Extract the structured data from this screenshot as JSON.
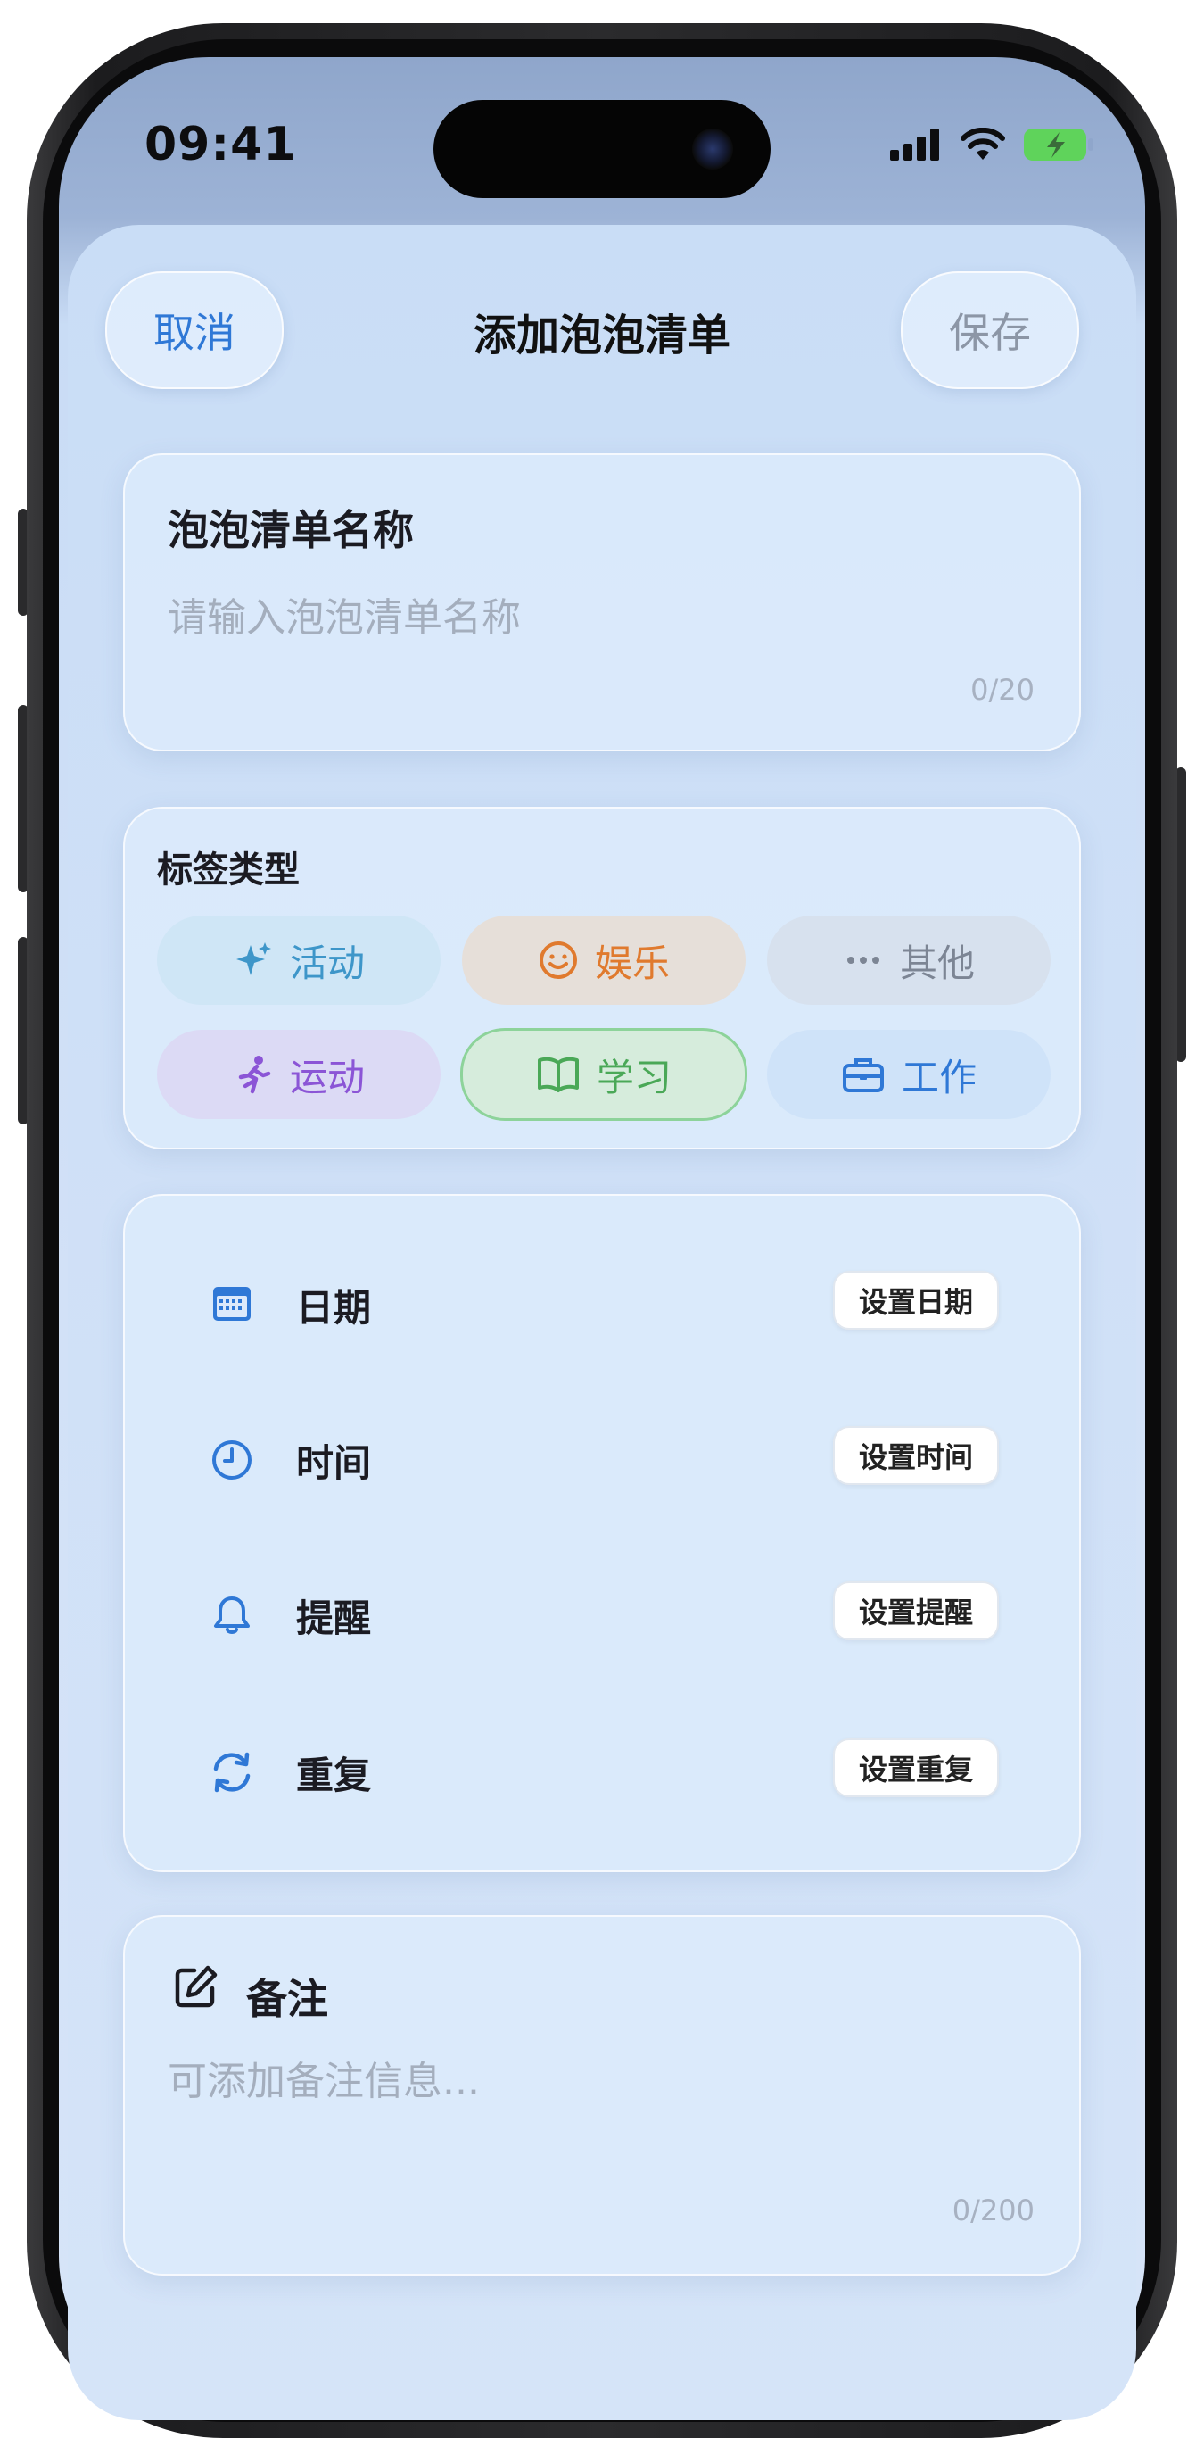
{
  "status_bar": {
    "time": "09:41"
  },
  "nav": {
    "cancel_label": "取消",
    "title": "添加泡泡清单",
    "save_label": "保存"
  },
  "name_card": {
    "label": "泡泡清单名称",
    "placeholder": "请输入泡泡清单名称",
    "counter": "0/20"
  },
  "tags": {
    "label": "标签类型",
    "items": [
      {
        "label": "活动",
        "icon": "sparkles-icon",
        "color": "#3e96c9",
        "bg": "#cfe6f6",
        "selected": false
      },
      {
        "label": "娱乐",
        "icon": "smile-icon",
        "color": "#e07a2e",
        "bg": "#e6dfd9",
        "selected": false
      },
      {
        "label": "其他",
        "icon": "more-icon",
        "color": "#7c8594",
        "bg": "#d7e1ee",
        "selected": false
      },
      {
        "label": "运动",
        "icon": "run-icon",
        "color": "#8b55d6",
        "bg": "#dcdaf5",
        "selected": false
      },
      {
        "label": "学习",
        "icon": "book-icon",
        "color": "#4aa857",
        "bg": "#d6ecdc",
        "selected": true
      },
      {
        "label": "工作",
        "icon": "briefcase-icon",
        "color": "#2f78d6",
        "bg": "#cfe3f9",
        "selected": false
      }
    ]
  },
  "settings": {
    "rows": [
      {
        "label": "日期",
        "icon": "calendar-icon",
        "button": "设置日期"
      },
      {
        "label": "时间",
        "icon": "clock-icon",
        "button": "设置时间"
      },
      {
        "label": "提醒",
        "icon": "bell-icon",
        "button": "设置提醒"
      },
      {
        "label": "重复",
        "icon": "repeat-icon",
        "button": "设置重复"
      }
    ]
  },
  "notes": {
    "label": "备注",
    "icon": "edit-icon",
    "placeholder": "可添加备注信息...",
    "counter": "0/200"
  },
  "colors": {
    "accent": "#2f78d6",
    "muted": "#a4aebd"
  }
}
